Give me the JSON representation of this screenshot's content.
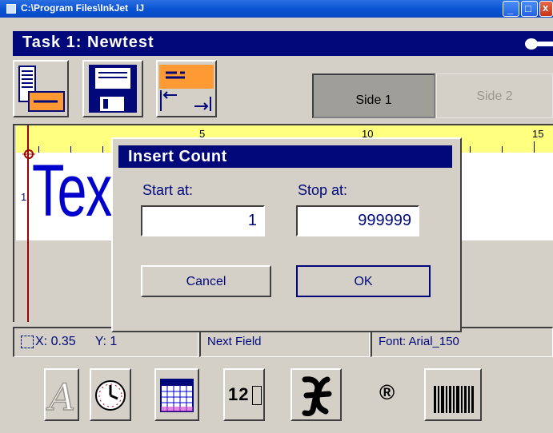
{
  "window": {
    "title": "C:\\Program Files\\InkJet   IJ"
  },
  "task": {
    "label": "Task 1: Newtest"
  },
  "sides": {
    "side1": "Side 1",
    "side2": "Side 2"
  },
  "ruler": {
    "labels": [
      "5",
      "10",
      "15"
    ]
  },
  "canvas": {
    "line_number": "1",
    "text_preview": "Tex"
  },
  "status": {
    "x": "X: 0.35",
    "y": "Y: 1",
    "field": "Next Field",
    "font": "Font: Arial_150"
  },
  "dialog": {
    "title": "Insert Count",
    "start_label": "Start at:",
    "stop_label": "Stop at:",
    "start_value": "1",
    "stop_value": "999999",
    "cancel": "Cancel",
    "ok": "OK"
  },
  "toolbar_bottom": {
    "counter_digits": "12",
    "registered_symbol": "®"
  },
  "icons": {
    "top": [
      "text-document-icon",
      "save-disk-icon",
      "layout-spacing-icon"
    ],
    "bottom": [
      "text-font-icon",
      "clock-icon",
      "calendar-icon",
      "counter-icon",
      "script-x-icon",
      "registered-icon",
      "barcode-icon"
    ]
  }
}
